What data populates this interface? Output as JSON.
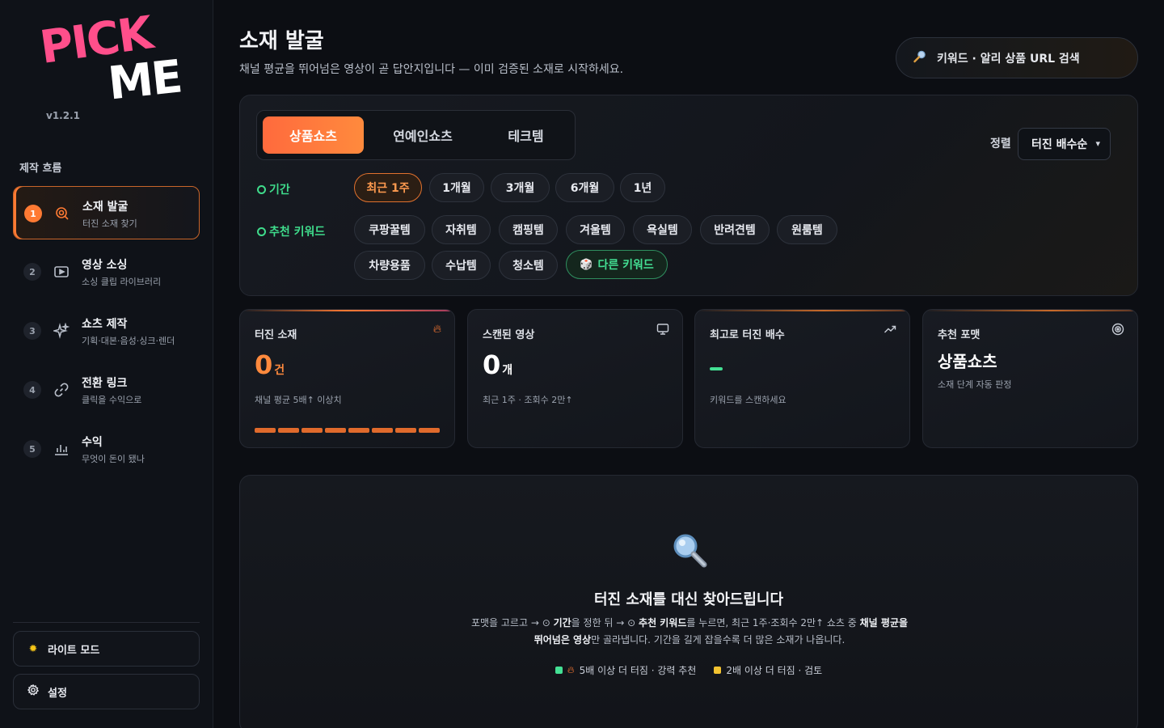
{
  "app": {
    "logo_top": "PICK",
    "logo_bottom": "ME",
    "version": "v1.2.1"
  },
  "sidebar": {
    "section_title": "제작 흐름",
    "steps": [
      {
        "num": "1",
        "name": "소재 발굴",
        "desc": "터진 소재 찾기",
        "icon": "search-target-icon"
      },
      {
        "num": "2",
        "name": "영상 소싱",
        "desc": "소싱 클립 라이브러리",
        "icon": "video-icon"
      },
      {
        "num": "3",
        "name": "쇼츠 제작",
        "desc": "기획·대본·음성·싱크·렌더",
        "icon": "sparkle-icon"
      },
      {
        "num": "4",
        "name": "전환 링크",
        "desc": "클릭을 수익으로",
        "icon": "link-icon"
      },
      {
        "num": "5",
        "name": "수익",
        "desc": "무엇이 돈이 됐나",
        "icon": "bar-chart-icon"
      }
    ],
    "light_mode": "라이트 모드",
    "settings": "설정"
  },
  "header": {
    "title": "소재 발굴",
    "subtitle": "채널 평균을 뛰어넘은 영상이 곧 답안지입니다 — 이미 검증된 소재로 시작하세요.",
    "search_placeholder": "키워드 · 알리 상품 URL 검색"
  },
  "filters": {
    "tabs": [
      "상품쇼츠",
      "연예인쇼츠",
      "테크템"
    ],
    "active_tab": 0,
    "sort_label": "정렬",
    "sort_value": "터진 배수순",
    "period_label": "기간",
    "periods": [
      "최근 1주",
      "1개월",
      "3개월",
      "6개월",
      "1년"
    ],
    "active_period": 0,
    "keyword_label": "추천 키워드",
    "keywords": [
      "쿠팡꿀템",
      "자취템",
      "캠핑템",
      "겨울템",
      "욕실템",
      "반려견템",
      "원룸템",
      "차량용품",
      "수납템",
      "청소템"
    ],
    "other_keyword": "다른 키워드"
  },
  "stats": [
    {
      "title": "터진 소재",
      "value": "0",
      "unit": "건",
      "desc": "채널 평균 5배↑ 이상치",
      "icon": "flame-icon"
    },
    {
      "title": "스캔된 영상",
      "value": "0",
      "unit": "개",
      "desc": "최근 1주 · 조회수 2만↑",
      "icon": "monitor-icon"
    },
    {
      "title": "최고로 터진 배수",
      "value": "",
      "unit": "",
      "desc": "키워드를 스캔하세요",
      "icon": "trend-up-icon"
    },
    {
      "title": "추천 포맷",
      "value": "상품쇼츠",
      "unit": "",
      "desc": "소재 단계 자동 판정",
      "icon": "target-icon"
    }
  ],
  "empty_state": {
    "title": "터진 소재를 대신 찾아드립니다",
    "line_a1": "포맷을 고르고 → ",
    "line_a2": "기간",
    "line_a3": "을 정한 뒤 → ",
    "line_a4": "추천 키워드",
    "line_a5": "를 누르면, 최근 1주·조회수 2만↑ 쇼츠 중 ",
    "line_a6": "채널 평균을 뛰어넘은 영상",
    "line_a7": "만 골라냅니다. 기간을 길게 잡을수록 더 많은 소재가 나옵니다.",
    "legend_strong": "5배 이상 더 터짐 · 강력 추천",
    "legend_check": "2배 이상 더 터짐 · 검토"
  },
  "colors": {
    "accent": "#ff7a33",
    "brand_pink": "#ff4f8b",
    "green": "#44e094",
    "yellow": "#f2c230"
  }
}
